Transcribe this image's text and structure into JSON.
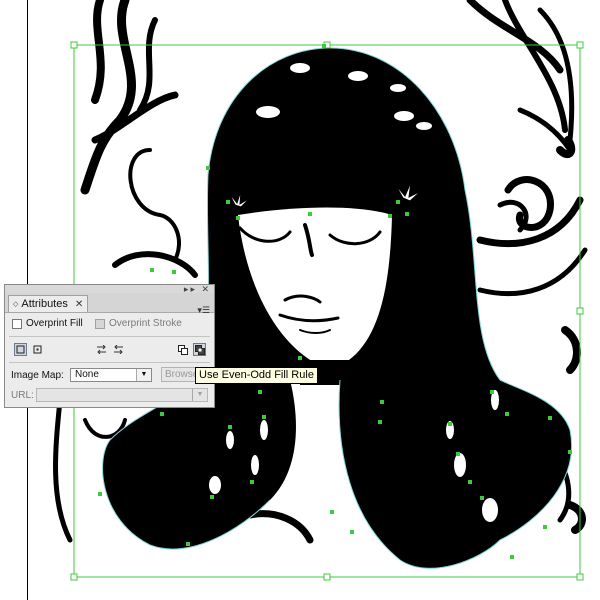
{
  "panel": {
    "tab_title": "Attributes",
    "overprint_fill_label": "Overprint Fill",
    "overprint_stroke_label": "Overprint Stroke",
    "image_map_label": "Image Map:",
    "image_map_value": "None",
    "browse_label": "Browse...",
    "url_label": "URL:"
  },
  "tooltip": {
    "text": "Use Even-Odd Fill Rule"
  },
  "colors": {
    "selection": "#3fc93f",
    "path_highlight": "#7fd6d6",
    "artwork": "#000000",
    "panel_bg": "#ececec",
    "tooltip_bg": "#ffffe1"
  },
  "icons": {
    "tab_arrows": "double-arrow-icon",
    "tab_close": "close-icon",
    "panel_menu": "panel-menu-icon",
    "center_off": "center-off-icon",
    "center_on": "center-on-icon",
    "reverse_direction_off": "reverse-path-off-icon",
    "reverse_direction_on": "reverse-path-on-icon",
    "nonzero_rule": "nonzero-fill-rule-icon",
    "evenodd_rule": "evenodd-fill-rule-icon"
  }
}
